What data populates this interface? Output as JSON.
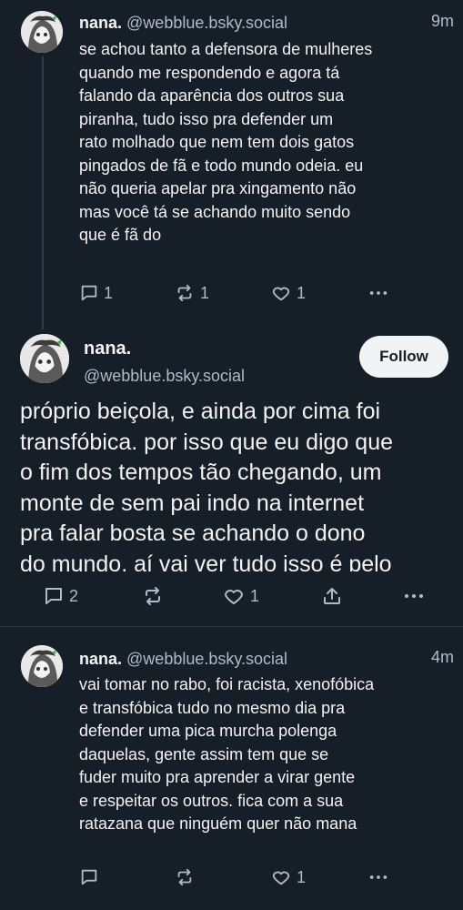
{
  "posts": [
    {
      "display_name": "nana.",
      "handle": "@webblue.bsky.social",
      "time": "9m",
      "text": "se achou tanto a defensora de mulheres\nquando me respondendo e agora tá\nfalando da aparência dos outros sua\npiranha, tudo isso pra defender um\nrato molhado que nem tem dois gatos\npingados de fã e todo mundo odeia. eu\nnão queria apelar pra xingamento não\nmas você tá se achando muito sendo\nque é fã do",
      "reply_count": "1",
      "repost_count": "1",
      "like_count": "1"
    },
    {
      "display_name": "nana.",
      "handle": "@webblue.bsky.social",
      "follow_label": "Follow",
      "text": "próprio beiçola, e ainda por cima foi\ntransfóbica. por isso que eu digo que\no fim dos tempos tão chegando, um\nmonte de sem pai indo na internet\npra falar bosta se achando o dono\ndo mundo, aí vai ver tudo isso é pelo",
      "reply_count": "2",
      "like_count": "1"
    },
    {
      "display_name": "nana.",
      "handle": "@webblue.bsky.social",
      "time": "4m",
      "text": "vai tomar no rabo, foi racista, xenofóbica\ne transfóbica tudo no mesmo dia pra\ndefender uma pica murcha polenga\ndaquelas, gente assim tem que se\nfuder muito pra aprender a virar gente\ne respeitar os outros. fica com a sua\nratazana que ninguém quer não mana",
      "like_count": "1"
    }
  ],
  "icons": {
    "reply": "speech-bubble-icon",
    "repost": "repost-arrows-icon",
    "like": "heart-icon",
    "more": "ellipsis-icon",
    "share": "share-icon"
  },
  "colors": {
    "background": "#161e27",
    "text": "#f1f3f5",
    "muted": "#aebbc9",
    "button": "#f1f3f5"
  }
}
